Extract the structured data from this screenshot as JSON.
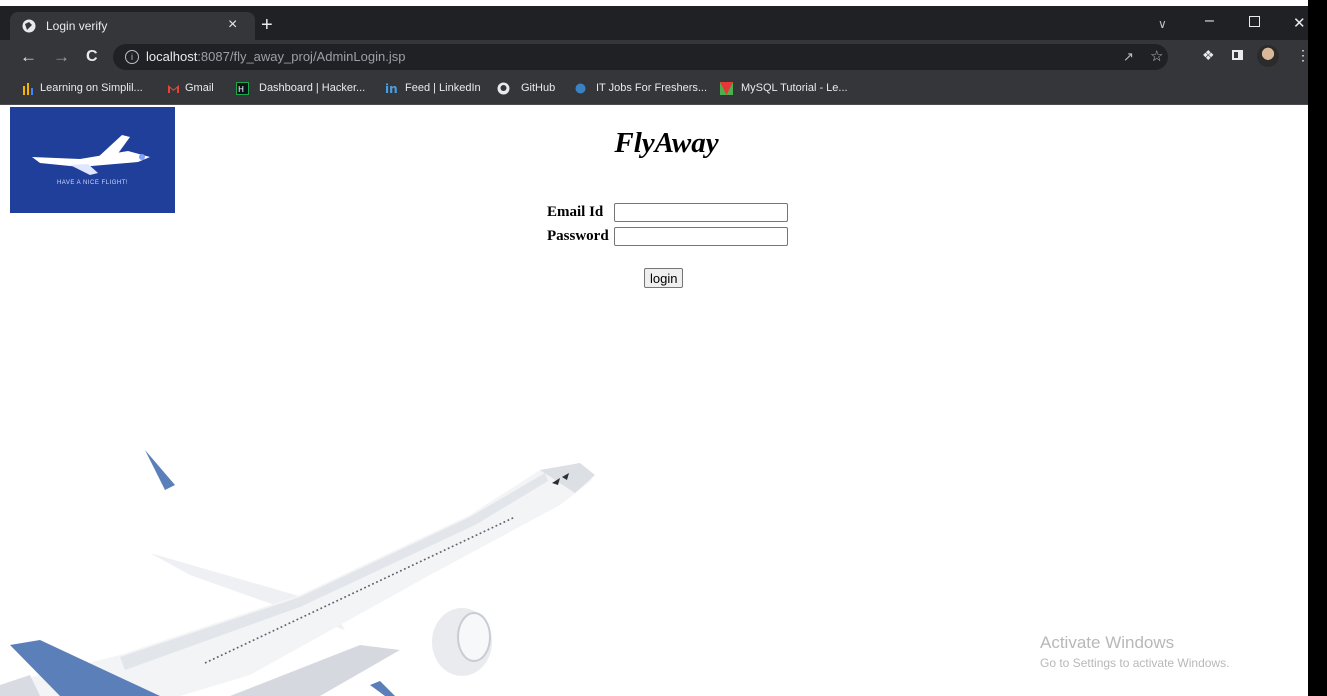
{
  "browser": {
    "tab": {
      "title": "Login verify",
      "close": "×",
      "new_tab": "+"
    },
    "nav": {
      "back": "←",
      "forward": "→",
      "reload": "C"
    },
    "url": {
      "host": "localhost",
      "rest": ":8087/fly_away_proj/AdminLogin.jsp"
    },
    "bookmarks": [
      "Learning on Simplil...",
      "Gmail",
      "Dashboard | Hacker...",
      "Feed | LinkedIn",
      "GitHub",
      "IT Jobs For Freshers...",
      "MySQL Tutorial - Le..."
    ],
    "icons": {
      "favicon": "globe-icon",
      "info": "info-icon",
      "share": "share-icon",
      "star": "star-icon",
      "extensions": "puzzle-icon",
      "menu": "kebab-menu-icon"
    },
    "colors": {
      "frame": "#202124",
      "toolbar": "#35363a",
      "text": "#e8eaed"
    }
  },
  "page": {
    "title": "FlyAway",
    "logo_tagline": "HAVE A NICE FLIGHT!",
    "form": {
      "email_label": "Email Id",
      "email_value": "",
      "password_label": "Password",
      "password_value": "",
      "login_label": "login"
    },
    "colors": {
      "logo_bg": "#1f3f9a",
      "plane_accent": "#5b7fb8"
    }
  },
  "watermark": {
    "title": "Activate Windows",
    "subtitle": "Go to Settings to activate Windows."
  }
}
